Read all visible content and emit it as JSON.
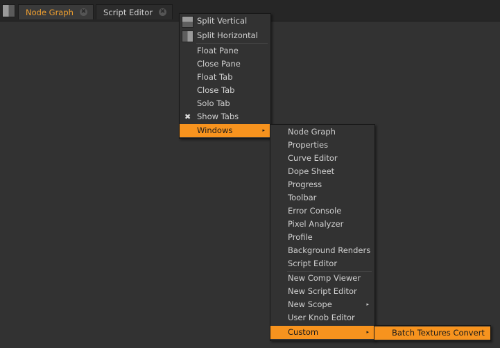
{
  "tabs": [
    {
      "label": "Node Graph",
      "close": "✖"
    },
    {
      "label": "Script Editor",
      "close": "✖"
    }
  ],
  "menu_main": {
    "items": [
      "Split Vertical",
      "Split Horizontal",
      "Float Pane",
      "Close Pane",
      "Float Tab",
      "Close Tab",
      "Solo Tab",
      "Show Tabs",
      "Windows"
    ],
    "show_tabs_check": "✖",
    "submenu_arrow": "▸"
  },
  "menu_windows": {
    "items": [
      "Node Graph",
      "Properties",
      "Curve Editor",
      "Dope Sheet",
      "Progress",
      "Toolbar",
      "Error Console",
      "Pixel Analyzer",
      "Profile",
      "Background Renders",
      "Script Editor",
      "New Comp Viewer",
      "New Script Editor",
      "New Scope",
      "User Knob Editor",
      "Custom"
    ],
    "submenu_arrow": "▸"
  },
  "menu_custom": {
    "items": [
      "Batch Textures Convert"
    ]
  },
  "colors": {
    "accent": "#f7931e",
    "background": "#323232",
    "active_tab_text": "#f0a030"
  }
}
